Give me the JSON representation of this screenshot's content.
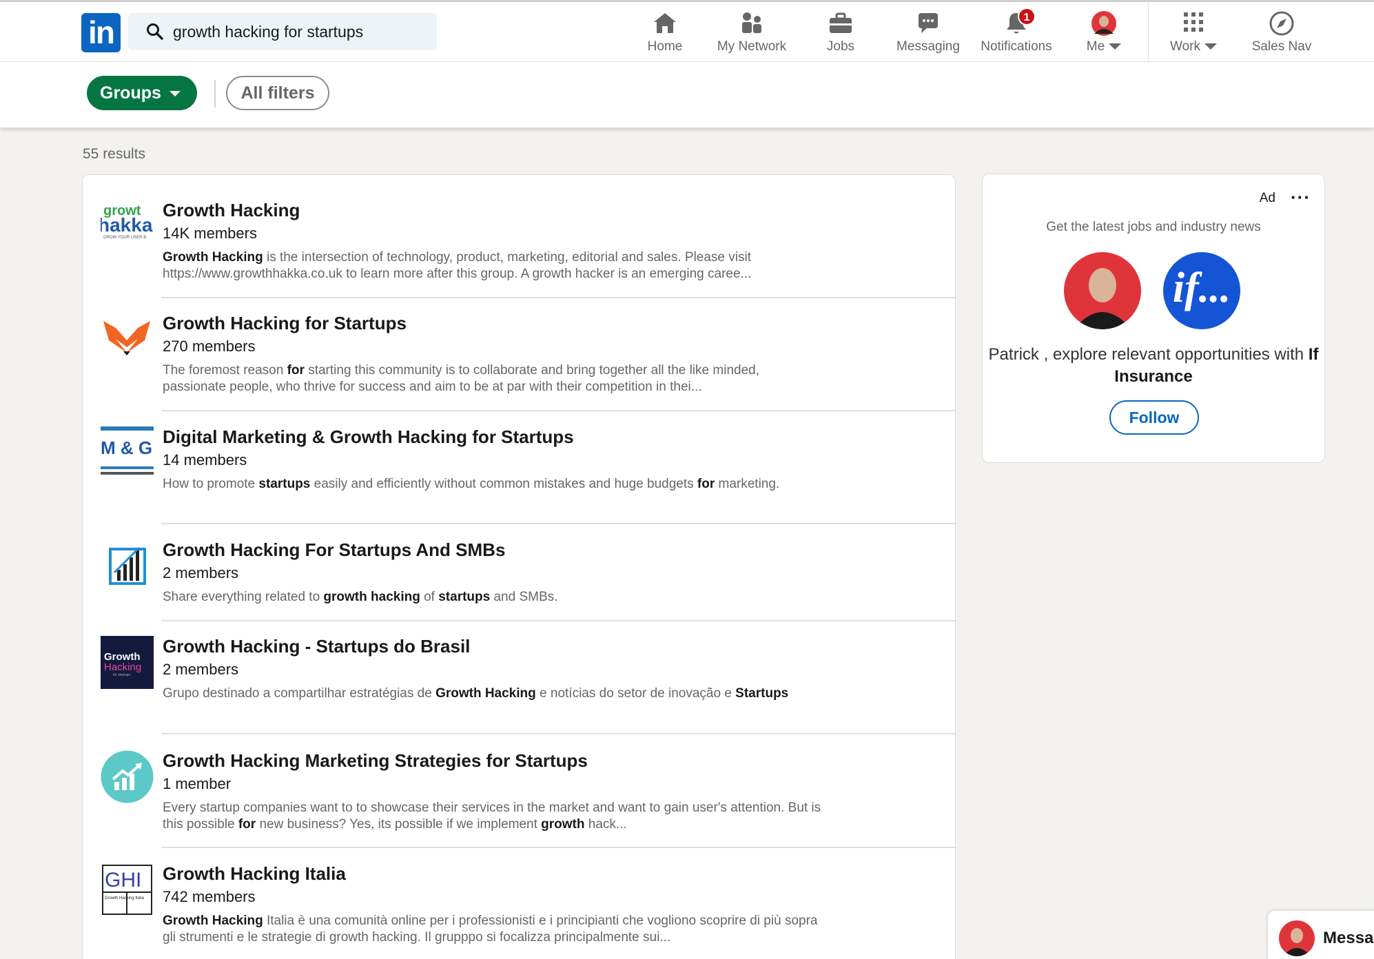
{
  "nav": {
    "search_query": "growth hacking for startups",
    "items": [
      {
        "label": "Home"
      },
      {
        "label": "My Network"
      },
      {
        "label": "Jobs"
      },
      {
        "label": "Messaging"
      },
      {
        "label": "Notifications",
        "badge": "1"
      },
      {
        "label": "Me"
      },
      {
        "label": "Work"
      },
      {
        "label": "Sales Nav"
      }
    ]
  },
  "filters": {
    "groups_label": "Groups",
    "all_filters_label": "All filters"
  },
  "results_count": "55 results",
  "results": [
    {
      "title": "Growth Hacking",
      "members": "14K members",
      "desc_1": "Growth Hacking",
      "desc_2": " is the intersection of technology, product, marketing, editorial and sales. Please visit https://www.growthhakka.co.uk to learn more after this group. A growth hacker is an emerging caree..."
    },
    {
      "title": "Growth Hacking for Startups",
      "members": "270 members",
      "desc_1": "The foremost reason ",
      "desc_2": "for",
      "desc_3": " starting this community is to collaborate and bring together all the like minded, passionate people, who thrive for success and aim to be at par with their competition in thei..."
    },
    {
      "title": "Digital Marketing & Growth Hacking for Startups",
      "members": "14 members",
      "desc_1": "How to promote ",
      "desc_2": "startups",
      "desc_3": " easily and efficiently without common mistakes and huge budgets ",
      "desc_4": "for",
      "desc_5": " marketing."
    },
    {
      "title": "Growth Hacking For Startups And SMBs",
      "members": "2 members",
      "desc_1": "Share everything related to ",
      "desc_2": "growth hacking",
      "desc_3": " of ",
      "desc_4": "startups",
      "desc_5": " and SMBs."
    },
    {
      "title": "Growth Hacking - Startups do Brasil",
      "members": "2 members",
      "desc_1": "Grupo destinado a compartilhar estratégias de ",
      "desc_2": "Growth Hacking",
      "desc_3": " e notícias do setor de inovação e ",
      "desc_4": "Startups"
    },
    {
      "title": "Growth Hacking Marketing Strategies for Startups",
      "members": "1 member",
      "desc_1": "Every startup companies want to to showcase their services in the market and want to gain user's attention. But is this possible ",
      "desc_2": "for",
      "desc_3": " new business? Yes, its possible if we implement ",
      "desc_4": "growth",
      "desc_5": " hack..."
    },
    {
      "title": "Growth Hacking Italia",
      "members": "742 members",
      "desc_1": "Growth Hacking",
      "desc_2": " Italia è una comunità online per i professionisti e i principianti che vogliono scoprire di più sopra gli strumenti e le strategie di growth hacking. Il grupppo si focalizza principalmente sui..."
    }
  ],
  "logos": {
    "growthhakka_top": "growt",
    "growthhakka_main": "hakka",
    "growthhakka_tag": "GROW YOUR USER B",
    "dmgh": "M & G",
    "brasil_top": "Growth",
    "brasil_mid": "Hacking",
    "brasil_sub": "for startups",
    "italia": "GHI",
    "italia_sub": "Growth Hacking Italia"
  },
  "ad": {
    "label": "Ad",
    "subtitle": "Get the latest jobs and industry news",
    "msg_1": "Patrick , explore relevant opportunities with ",
    "msg_company": "If Insurance",
    "if_logo": "if...",
    "follow": "Follow"
  },
  "messaging": {
    "label": "Messaging"
  },
  "colors": {
    "brand": "#0a66c2",
    "groups_pill": "#057642",
    "badge": "#cc1016"
  }
}
